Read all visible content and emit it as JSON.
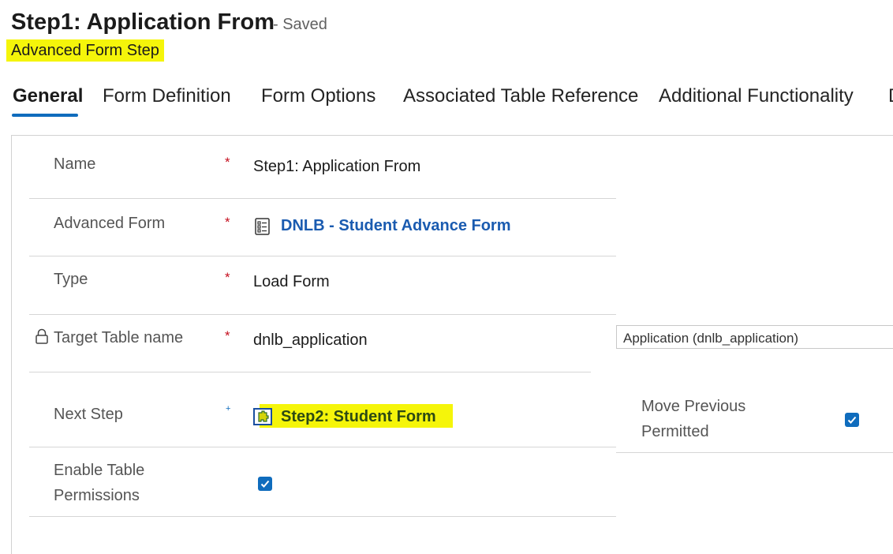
{
  "header": {
    "title": "Step1: Application From",
    "saved_status": "- Saved",
    "subtitle": "Advanced Form Step"
  },
  "tabs": [
    {
      "label": "General",
      "active": true
    },
    {
      "label": "Form Definition"
    },
    {
      "label": "Form Options"
    },
    {
      "label": "Associated Table Reference"
    },
    {
      "label": "Additional Functionality"
    },
    {
      "label": "D"
    }
  ],
  "form": {
    "name": {
      "label": "Name",
      "required": "*",
      "value": "Step1: Application From"
    },
    "advanced_form": {
      "label": "Advanced Form",
      "required": "*",
      "value": "DNLB - Student Advance Form"
    },
    "type": {
      "label": "Type",
      "required": "*",
      "value": "Load Form"
    },
    "target_table": {
      "label": "Target Table name",
      "required": "*",
      "value": "dnlb_application",
      "lookup_display": "Application (dnlb_application)"
    },
    "next_step": {
      "label": "Next Step",
      "required": "+",
      "value": "Step2: Student Form"
    },
    "move_previous": {
      "label_line1": "Move Previous",
      "label_line2": "Permitted",
      "checked": true
    },
    "enable_permissions": {
      "label_line1": "Enable Table",
      "label_line2": "Permissions",
      "checked": true
    }
  },
  "colors": {
    "accent": "#0f6cbd",
    "highlight": "#f5f50a",
    "link": "#1a5bb0",
    "required": "#c50f1f"
  },
  "icons": [
    "form-icon",
    "step-icon",
    "lock-icon",
    "checkmark-icon"
  ]
}
